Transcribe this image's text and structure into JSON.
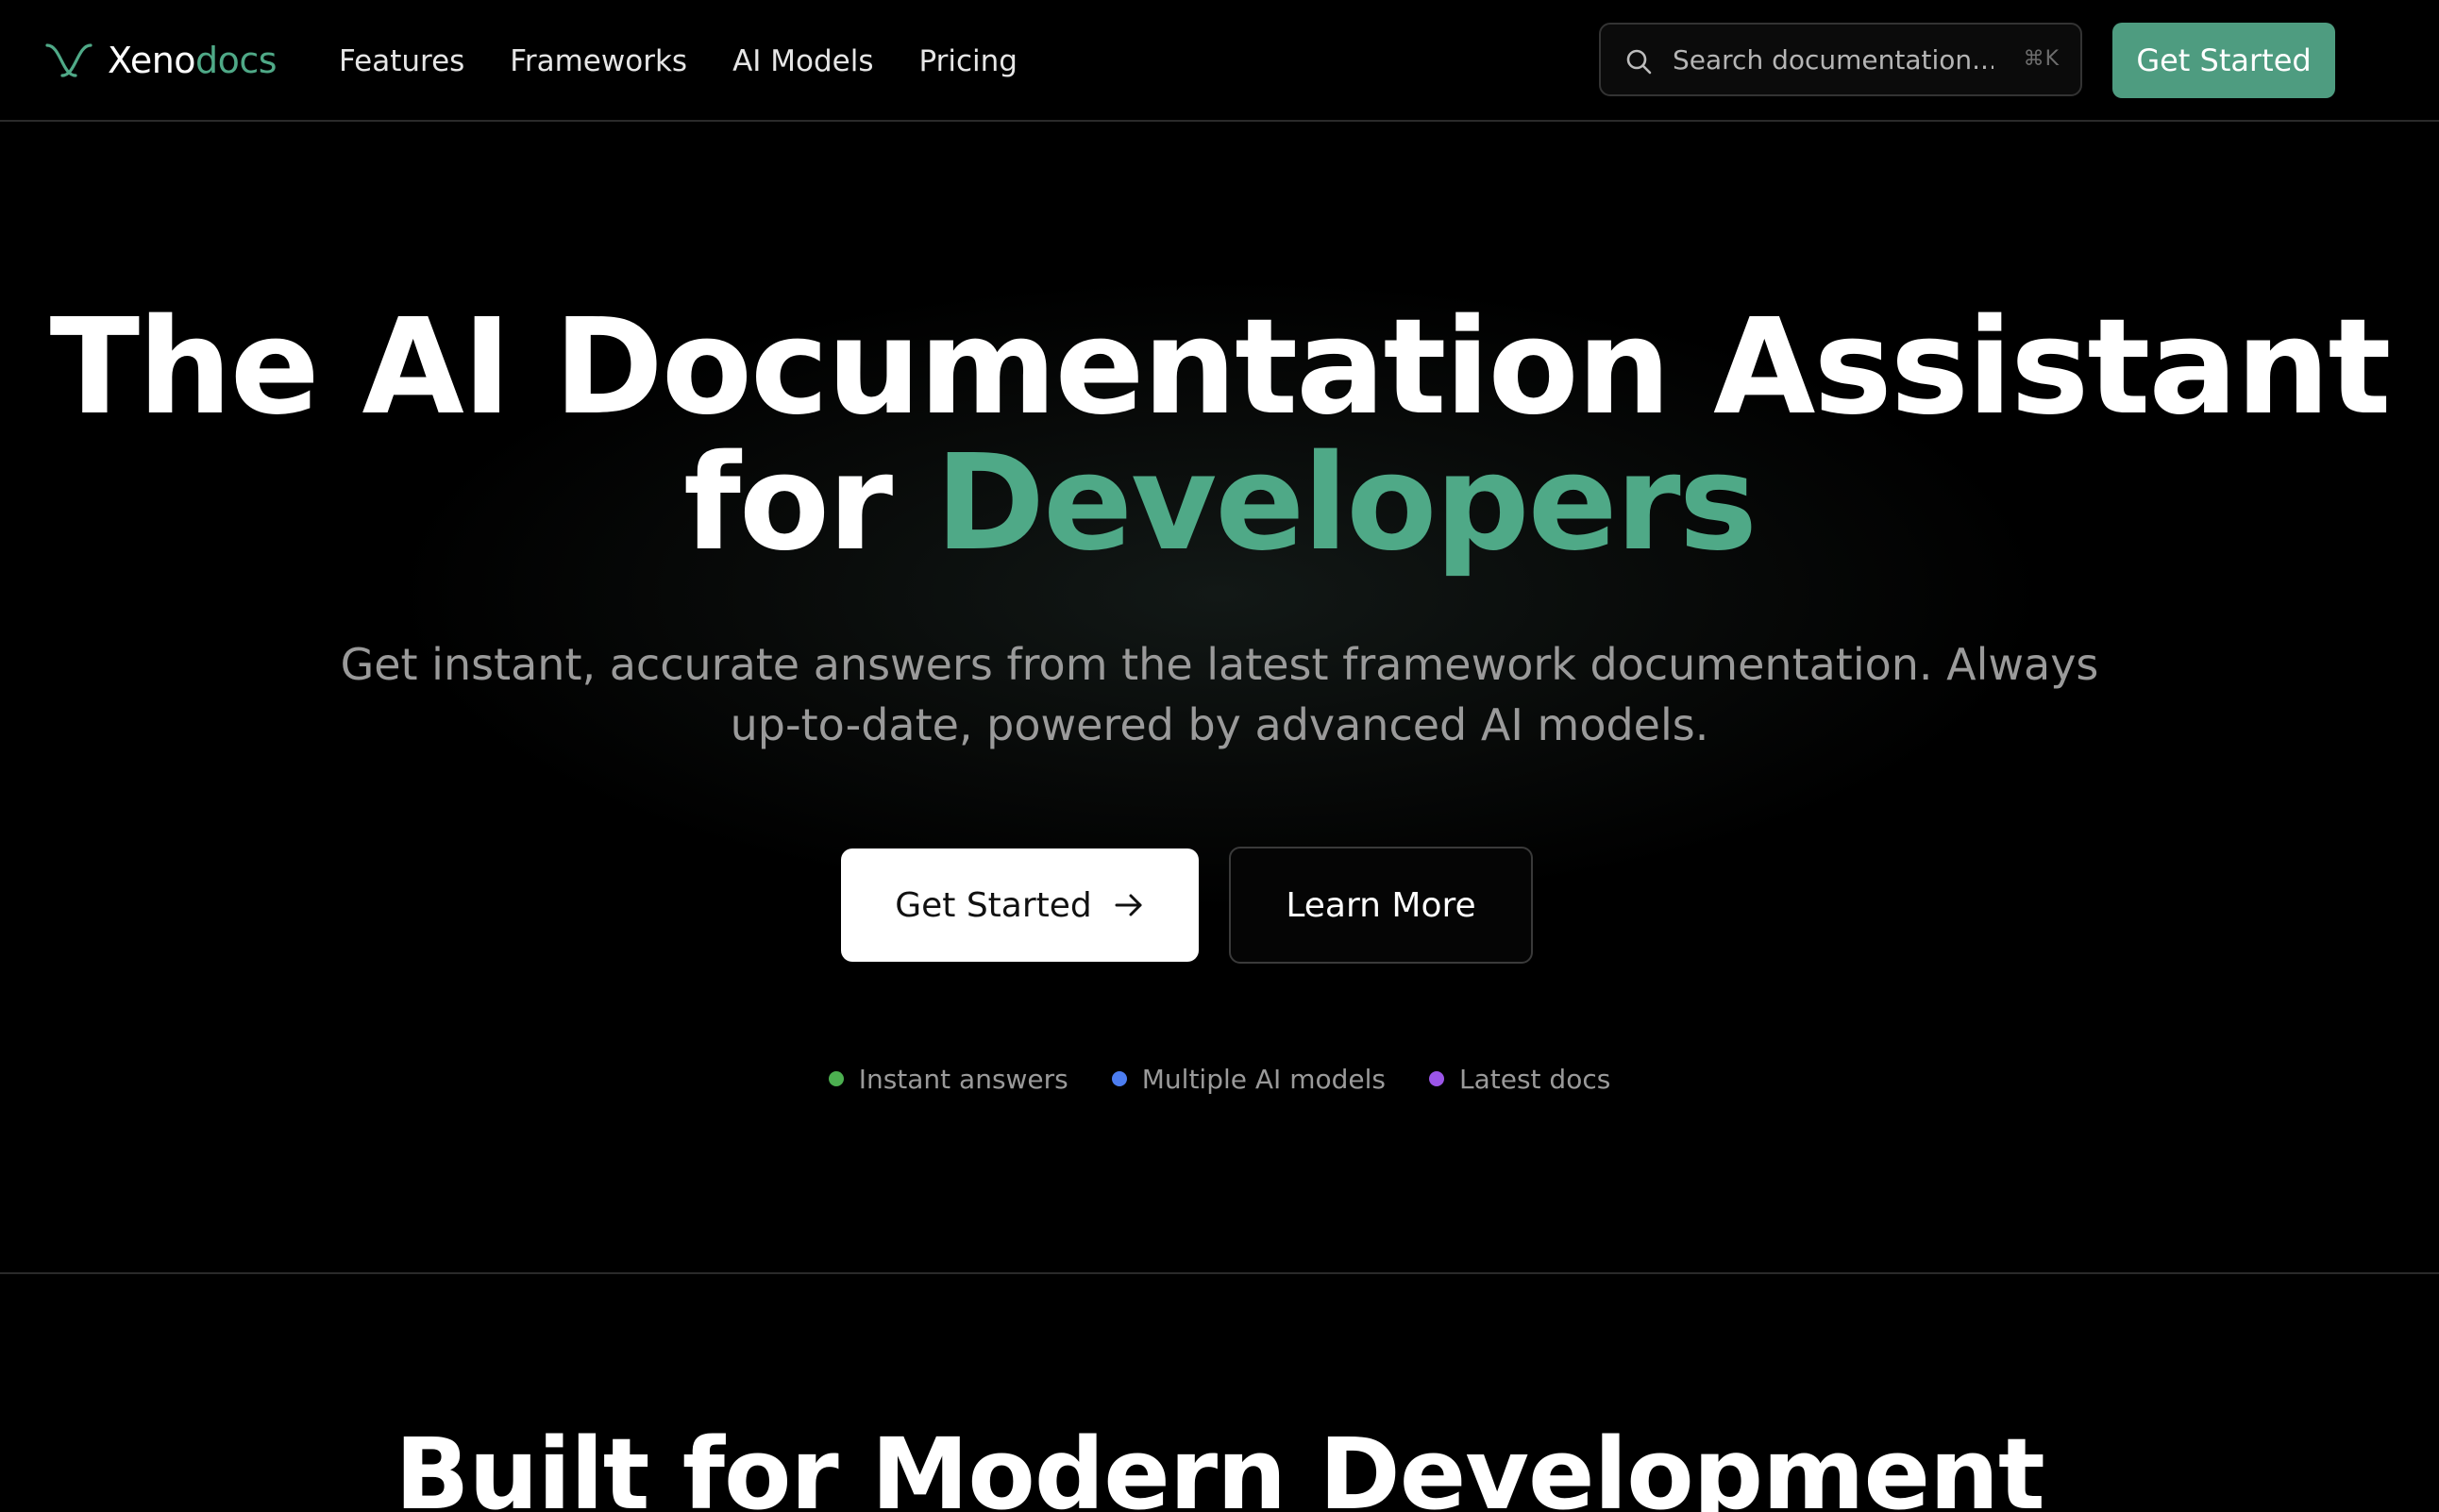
{
  "brand": {
    "name_primary": "Xeno",
    "name_accent": "docs",
    "accent_color": "#4fa987"
  },
  "nav": {
    "links": [
      "Features",
      "Frameworks",
      "AI Models",
      "Pricing"
    ],
    "search": {
      "placeholder": "Search documentation...",
      "shortcut": "⌘K"
    },
    "cta_label": "Get Started",
    "cta_color": "#4e9c80"
  },
  "hero": {
    "title_line1": "The AI Documentation Assistant",
    "title_line2_prefix": "for",
    "title_line2_accent": "Developers",
    "subtitle_line1": "Get instant, accurate answers from the latest framework documentation. Always",
    "subtitle_line2": "up-to-date, powered by advanced AI models.",
    "primary_button": "Get Started",
    "secondary_button": "Learn More",
    "features": [
      {
        "label": "Instant answers",
        "color": "#4caf50"
      },
      {
        "label": "Multiple AI models",
        "color": "#4c7df0"
      },
      {
        "label": "Latest docs",
        "color": "#9b55e8"
      }
    ]
  },
  "section": {
    "title": "Built for Modern Development"
  }
}
